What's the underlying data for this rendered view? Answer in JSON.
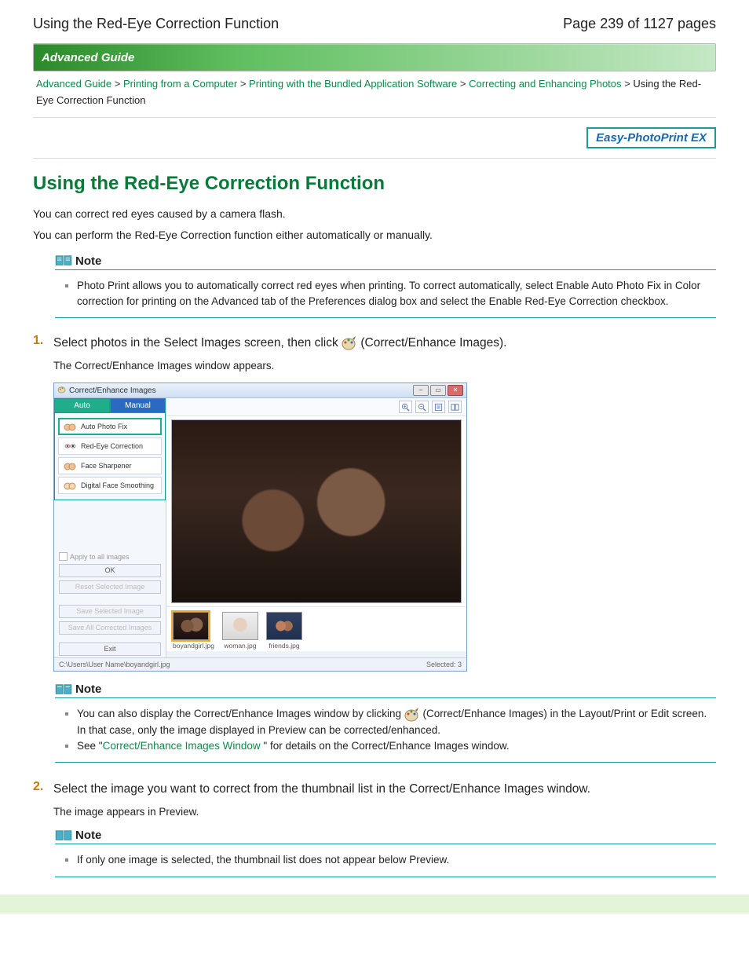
{
  "header": {
    "title": "Using the Red-Eye Correction Function",
    "page_label": "Page 239 of 1127 pages"
  },
  "advbar": "Advanced Guide",
  "crumbs": {
    "c1": "Advanced Guide",
    "c2": "Printing from a Computer",
    "c3": "Printing with the Bundled Application Software",
    "c4": "Correcting and Enhancing Photos",
    "c5": "Using the Red-Eye Correction Function"
  },
  "badge": "Easy-PhotoPrint EX",
  "h1": "Using the Red-Eye Correction Function",
  "intro1": "You can correct red eyes caused by a camera flash.",
  "intro2": "You can perform the Red-Eye Correction function either automatically or manually.",
  "note_label": "Note",
  "note1": "Photo Print allows you to automatically correct red eyes when printing. To correct automatically, select Enable Auto Photo Fix in Color correction for printing on the Advanced tab of the Preferences dialog box and select the Enable Red-Eye Correction checkbox.",
  "step1a": "Select photos in the Select Images screen, then click ",
  "step1b": " (Correct/Enhance Images).",
  "step1_sub": "The Correct/Enhance Images window appears.",
  "appwin": {
    "title": "Correct/Enhance Images",
    "tabs": {
      "auto": "Auto",
      "manual": "Manual"
    },
    "opts": {
      "o1": "Auto Photo Fix",
      "o2": "Red-Eye Correction",
      "o3": "Face Sharpener",
      "o4": "Digital Face Smoothing"
    },
    "apply_all": "Apply to all images",
    "btns": {
      "ok": "OK",
      "reset": "Reset Selected Image",
      "save": "Save Selected Image",
      "saveall": "Save All Corrected Images",
      "exit": "Exit"
    },
    "thumbs": {
      "t1": "boyandgirl.jpg",
      "t2": "woman.jpg",
      "t3": "friends.jpg"
    },
    "status_left": "C:\\Users\\User Name\\boyandgirl.jpg",
    "status_right": "Selected: 3"
  },
  "note2a": "You can also display the Correct/Enhance Images window by clicking ",
  "note2b": " (Correct/Enhance Images) in the Layout/Print or Edit screen. In that case, only the image displayed in Preview can be corrected/enhanced.",
  "note2c_pre": "See \"",
  "note2c_link": "Correct/Enhance Images Window",
  "note2c_post": " \" for details on the Correct/Enhance Images window.",
  "step2": "Select the image you want to correct from the thumbnail list in the Correct/Enhance Images window.",
  "step2_sub": "The image appears in Preview.",
  "note3": "If only one image is selected, the thumbnail list does not appear below Preview."
}
